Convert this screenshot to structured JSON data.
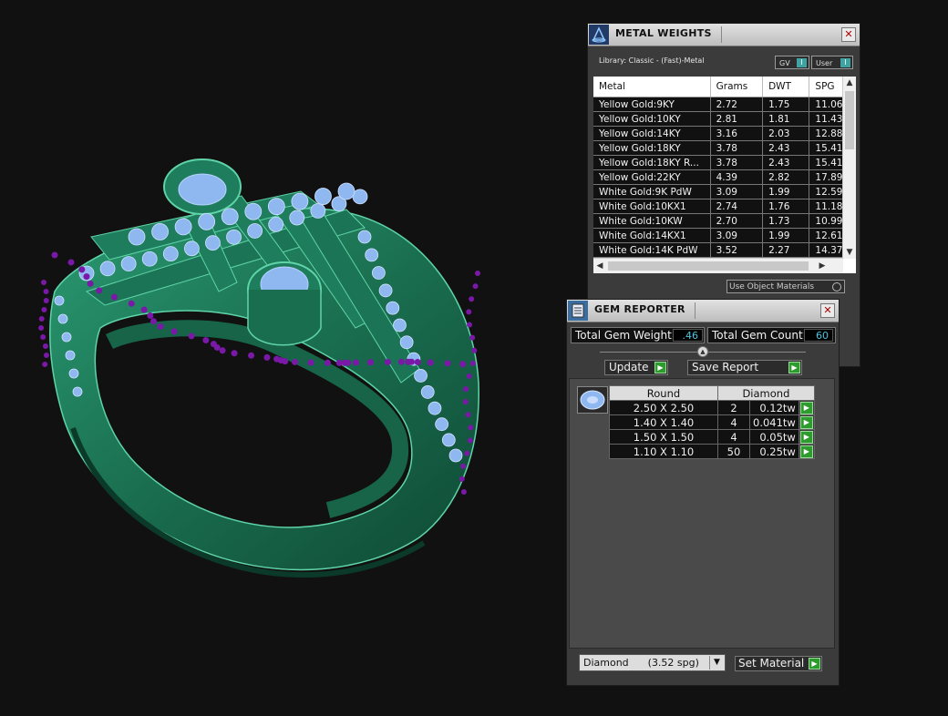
{
  "metal_weights": {
    "title": "METAL WEIGHTS",
    "close_glyph": "✕",
    "library_label": "Library: Classic - (Fast)-Metal",
    "gv_label": "GV",
    "user_label": "User",
    "toggle_glyph": "I",
    "columns": [
      "Metal",
      "Grams",
      "DWT",
      "SPG"
    ],
    "rows": [
      [
        "Yellow Gold:9KY",
        "2.72",
        "1.75",
        "11.06"
      ],
      [
        "Yellow Gold:10KY",
        "2.81",
        "1.81",
        "11.43"
      ],
      [
        "Yellow Gold:14KY",
        "3.16",
        "2.03",
        "12.88"
      ],
      [
        "Yellow Gold:18KY",
        "3.78",
        "2.43",
        "15.41"
      ],
      [
        "Yellow Gold:18KY R...",
        "3.78",
        "2.43",
        "15.41"
      ],
      [
        "Yellow Gold:22KY",
        "4.39",
        "2.82",
        "17.89"
      ],
      [
        "White Gold:9K PdW",
        "3.09",
        "1.99",
        "12.59"
      ],
      [
        "White Gold:10KX1",
        "2.74",
        "1.76",
        "11.18"
      ],
      [
        "White Gold:10KW",
        "2.70",
        "1.73",
        "10.99"
      ],
      [
        "White Gold:14KX1",
        "3.09",
        "1.99",
        "12.61"
      ],
      [
        "White Gold:14K PdW",
        "3.52",
        "2.27",
        "14.37"
      ]
    ],
    "use_object_materials_label": "Use Object Materials"
  },
  "gem_reporter": {
    "title": "GEM REPORTER",
    "close_glyph": "✕",
    "total_gem_weight_label": "Total Gem Weight",
    "total_gem_weight_value": ".46",
    "total_gem_count_label": "Total Gem Count",
    "total_gem_count_value": "60",
    "update_label": "Update",
    "save_report_label": "Save Report",
    "go_glyph": "▶",
    "table_headers": [
      "Round",
      "Diamond"
    ],
    "gems": [
      {
        "size": "2.50 X 2.50",
        "count": "2",
        "weight": "0.12tw"
      },
      {
        "size": "1.40 X 1.40",
        "count": "4",
        "weight": "0.041tw"
      },
      {
        "size": "1.50 X 1.50",
        "count": "4",
        "weight": "0.05tw"
      },
      {
        "size": "1.10 X 1.10",
        "count": "50",
        "weight": "0.25tw"
      }
    ],
    "material_select_value": "Diamond      (3.52 spg)",
    "dropdown_glyph": "▼",
    "set_material_label": "Set Material"
  },
  "colors": {
    "metal_green": "#1f7a5a",
    "gem_blue": "#8fb8f0",
    "prong_purple": "#7a18a8",
    "panel_bg": "#3b3b3b",
    "accent_cyan": "#4fc3dd",
    "go_green": "#2e9b2e"
  }
}
